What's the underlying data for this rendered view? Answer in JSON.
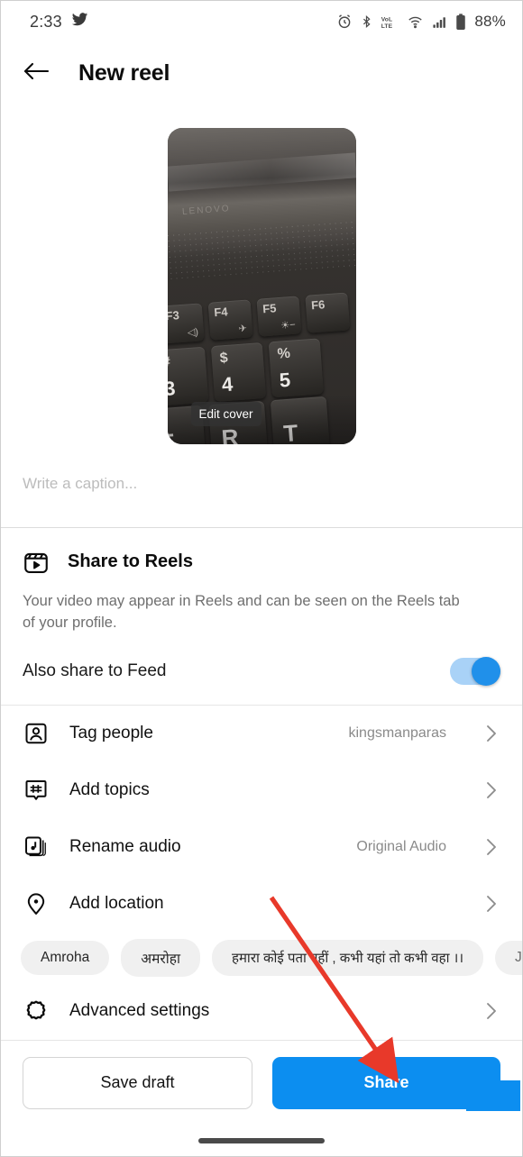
{
  "statusbar": {
    "time": "2:33",
    "twitter_icon": "twitter-bird-icon",
    "icons": [
      "alarm-icon",
      "bluetooth-icon",
      "volte-icon",
      "wifi-icon",
      "signal-icon",
      "battery-icon"
    ],
    "battery": "88%"
  },
  "header": {
    "back_icon": "back-arrow-icon",
    "title": "New reel"
  },
  "thumbnail": {
    "edit_cover_label": "Edit cover",
    "keys": {
      "f3": "F3",
      "f4": "F4",
      "f5": "F5",
      "f6": "F6",
      "n3_top": "#",
      "n3_bot": "3",
      "n4_top": "$",
      "n4_bot": "4",
      "n5_top": "%",
      "n5_bot": "5",
      "e": "E",
      "r": "R",
      "t": "T",
      "brand": "LENOVO"
    }
  },
  "caption": {
    "placeholder": "Write a caption...",
    "value": ""
  },
  "reels": {
    "icon": "reels-icon",
    "title": "Share to Reels",
    "description": "Your video may appear in Reels and can be seen on the Reels tab of your profile.",
    "feed_label": "Also share to Feed",
    "feed_toggle_on": true,
    "toggle_color": "#2090ea"
  },
  "options": [
    {
      "icon": "tag-people-icon",
      "label": "Tag people",
      "value": "kingsmanparas",
      "chevron": "chevron-right-icon"
    },
    {
      "icon": "hashtag-icon",
      "label": "Add topics",
      "value": "",
      "chevron": "chevron-right-icon"
    },
    {
      "icon": "audio-note-icon",
      "label": "Rename audio",
      "value": "Original Audio",
      "chevron": "chevron-right-icon"
    },
    {
      "icon": "location-pin-icon",
      "label": "Add location",
      "value": "",
      "chevron": "chevron-right-icon"
    },
    {
      "icon": "gear-icon",
      "label": "Advanced settings",
      "value": "",
      "chevron": "chevron-right-icon"
    }
  ],
  "location_chips": [
    "Amroha",
    "अमरोहा",
    "हमारा कोई पता नहीं , कभी यहां तो कभी वहा ।।",
    "Jewelle"
  ],
  "bottom": {
    "save_draft_label": "Save draft",
    "share_label": "Share",
    "share_color": "#0c8ef0"
  },
  "annotation": {
    "arrow_color": "#e8392a",
    "from": "300,995",
    "to": "427,1182"
  },
  "home_indicator": "home-indicator"
}
